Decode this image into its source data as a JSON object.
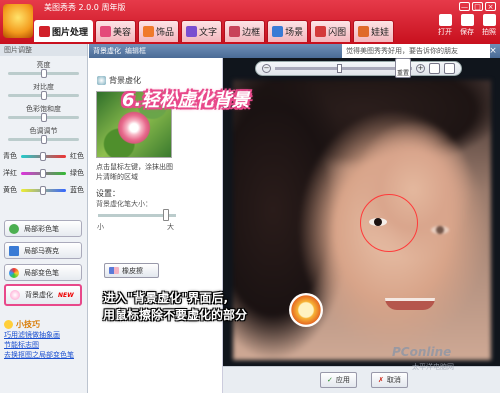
{
  "app": {
    "title": "美图秀秀 2.0.0 周年版",
    "window_controls": [
      "—",
      "□",
      "×"
    ],
    "tabs": [
      {
        "label": "图片处理",
        "active": true,
        "icon": "image-process-icon",
        "color": "#d1202a"
      },
      {
        "label": "美容",
        "active": false,
        "icon": "beauty-icon",
        "color": "#e44b7a"
      },
      {
        "label": "饰品",
        "active": false,
        "icon": "accessory-icon",
        "color": "#f07a2b"
      },
      {
        "label": "文字",
        "active": false,
        "icon": "text-icon",
        "color": "#7a4fd0"
      },
      {
        "label": "边框",
        "active": false,
        "icon": "frame-icon",
        "color": "#c8445a"
      },
      {
        "label": "场景",
        "active": false,
        "icon": "scene-icon",
        "color": "#3a7bd5"
      },
      {
        "label": "闪图",
        "active": false,
        "icon": "flash-icon",
        "color": "#d43a3a"
      },
      {
        "label": "娃娃",
        "active": false,
        "icon": "doll-icon",
        "color": "#e06a2a"
      }
    ],
    "top_actions": [
      {
        "label": "打开",
        "icon": "open-icon"
      },
      {
        "label": "保存",
        "icon": "save-icon"
      },
      {
        "label": "拍照",
        "icon": "camera-icon"
      }
    ]
  },
  "sidebar": {
    "header": "图片调整",
    "sliders": [
      {
        "label": "亮度",
        "level": 0.5
      },
      {
        "label": "对比度",
        "level": 0.5
      },
      {
        "label": "色彩饱和度",
        "level": 0.5
      },
      {
        "label": "色调调节",
        "level": 0.5
      }
    ],
    "color_rows": [
      {
        "left": "青色",
        "right": "红色",
        "level": 0.5
      },
      {
        "left": "洋红",
        "right": "绿色",
        "level": 0.5
      },
      {
        "left": "黄色",
        "right": "蓝色",
        "level": 0.5
      }
    ],
    "tools": [
      {
        "label": "局部彩色笔",
        "icon": "color-brush-icon",
        "active": false,
        "new": false
      },
      {
        "label": "局部马赛克",
        "icon": "mosaic-icon",
        "active": false,
        "new": false
      },
      {
        "label": "局部变色笔",
        "icon": "recolor-brush-icon",
        "active": false,
        "new": false
      },
      {
        "label": "背景虚化",
        "icon": "background-blur-icon",
        "active": true,
        "new": true
      }
    ],
    "new_badge": "NEW",
    "tips": {
      "title": "小技巧",
      "links": [
        "巧用滤镜做抽象画",
        "节能标志图",
        "去换抠图之局部变色笔"
      ]
    }
  },
  "dialog": {
    "title": "背景虚化",
    "crumb": "编辑框",
    "notice": "觉得美图秀秀好用，要告诉你的朋友",
    "close": "×",
    "panel": {
      "title": "背景虚化",
      "description": "点击鼠标左键，涂抹出图片清晰的区域",
      "settings_label": "设置：",
      "size_label": "背景虚化笔大小：",
      "size_min": "小",
      "size_max": "大",
      "size_level": 0.9,
      "eraser": "橡皮擦"
    },
    "zoom": {
      "minus": "−",
      "plus": "+",
      "reset": "重置",
      "level": 0.45
    },
    "buttons": {
      "apply": "应用",
      "cancel": "取消",
      "apply_mark": "✓",
      "cancel_mark": "✗"
    }
  },
  "overlay": {
    "step": "6.轻松虚化背景",
    "caption_line1": "进入\"背景虚化\"界面后,",
    "caption_line2": "用鼠标擦除不要虚化的部分",
    "watermark": "PConline",
    "watermark_sub": "太平洋电脑网",
    "colors": {
      "accent": "#e8488a",
      "ring": "#ff3a3a",
      "brand": "#c8101e"
    }
  }
}
